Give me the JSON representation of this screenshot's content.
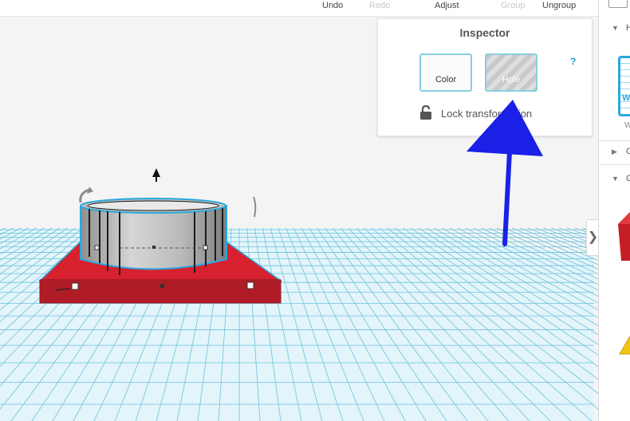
{
  "toolbar": {
    "undo": "Undo",
    "redo": "Redo",
    "adjust": "Adjust",
    "group": "Group",
    "ungroup": "Ungroup"
  },
  "inspector": {
    "title": "Inspector",
    "color_label": "Color",
    "hole_label": "Hole",
    "help": "?",
    "lock_label": "Lock transformation"
  },
  "side_panel": {
    "row1": "H",
    "row2": "G",
    "row3": "G",
    "thumb_caption": "W",
    "collapse": "❯"
  },
  "colors": {
    "grid_line": "#6cc3dc",
    "grid_fill": "#e3f4fa",
    "selection": "#29a8de",
    "base_plate": "#c8202b",
    "annotation": "#1a20e6"
  },
  "icons": [
    "lock-icon",
    "expand-arrow-icon",
    "rotate-handle-icon",
    "move-up-icon",
    "chevron-right-icon"
  ]
}
